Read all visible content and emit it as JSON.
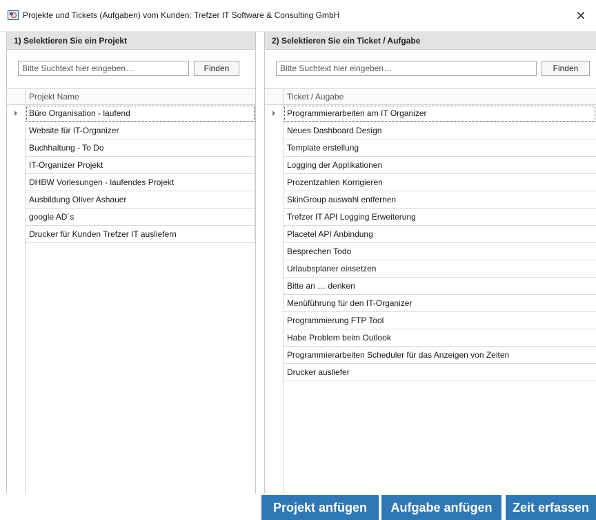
{
  "window": {
    "title": "Projekte und Tickets (Aufgaben) vom Kunden: Trefzer IT Software & Consulting GmbH",
    "close_symbol": "✕"
  },
  "left_panel": {
    "header": "1) Selektieren Sie ein Projekt",
    "search_placeholder": "Bitte Suchtext hier eingeben…",
    "find_label": "Finden",
    "column_header": "Projekt Name",
    "selected_index": 0,
    "rows": [
      "Büro Organisation - laufend",
      "Website für IT-Organizer",
      "Buchhaltung - To Do",
      "IT-Organizer Projekt",
      "DHBW Vorlesungen - laufendes Projekt",
      "Ausbildung Oliver Ashauer",
      "google AD´s",
      "Drucker für Kunden Trefzer IT ausliefern"
    ]
  },
  "right_panel": {
    "header": "2) Selektieren Sie ein Ticket / Aufgabe",
    "search_placeholder": "Bitte Suchtext hier eingeben…",
    "find_label": "Finden",
    "column_header": "Ticket / Augabe",
    "selected_index": 0,
    "rows": [
      "Programmierarbeiten am IT Organizer",
      "Neues Dashboard Design",
      "Template erstellung",
      "Logging der Applikationen",
      "Prozentzahlen Korrigieren",
      "SkinGroup auswahl entfernen",
      "Trefzer IT API Logging Erweiterung",
      "Placetel API Anbindung",
      "Besprechen Todo",
      "Urlaubsplaner einsetzen",
      "Bitte an … denken",
      "Menüführung für den IT-Organizer",
      "Programmierung FTP Tool",
      "Habe Problem beim Outlook",
      "Programmierarbeiten Scheduler für das Anzeigen von Zeiten",
      "Drucker ausliefer"
    ]
  },
  "actions": {
    "add_project": "Projekt anfügen",
    "add_task": "Aufgabe anfügen",
    "log_time": "Zeit erfassen"
  },
  "colors": {
    "action_button": "#2f77b5",
    "header_bg": "#e3e3e3"
  }
}
